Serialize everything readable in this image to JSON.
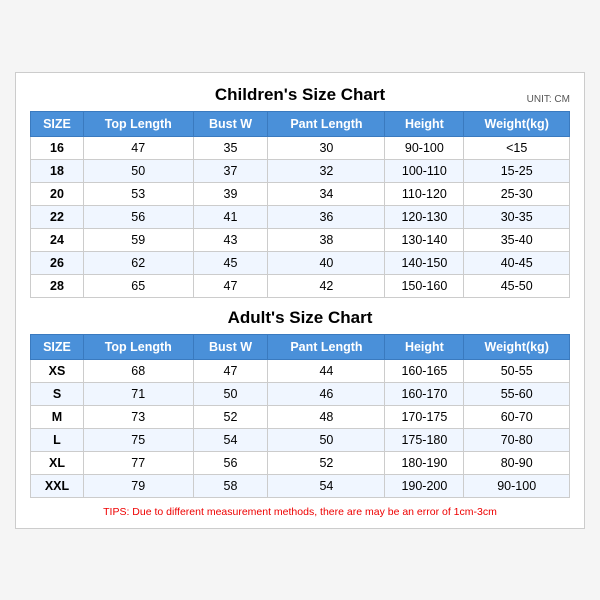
{
  "children": {
    "title": "Children's Size Chart",
    "unit": "UNIT: CM",
    "headers": [
      "SIZE",
      "Top Length",
      "Bust W",
      "Pant Length",
      "Height",
      "Weight(kg)"
    ],
    "rows": [
      [
        "16",
        "47",
        "35",
        "30",
        "90-100",
        "<15"
      ],
      [
        "18",
        "50",
        "37",
        "32",
        "100-110",
        "15-25"
      ],
      [
        "20",
        "53",
        "39",
        "34",
        "110-120",
        "25-30"
      ],
      [
        "22",
        "56",
        "41",
        "36",
        "120-130",
        "30-35"
      ],
      [
        "24",
        "59",
        "43",
        "38",
        "130-140",
        "35-40"
      ],
      [
        "26",
        "62",
        "45",
        "40",
        "140-150",
        "40-45"
      ],
      [
        "28",
        "65",
        "47",
        "42",
        "150-160",
        "45-50"
      ]
    ]
  },
  "adult": {
    "title": "Adult's Size Chart",
    "headers": [
      "SIZE",
      "Top Length",
      "Bust W",
      "Pant Length",
      "Height",
      "Weight(kg)"
    ],
    "rows": [
      [
        "XS",
        "68",
        "47",
        "44",
        "160-165",
        "50-55"
      ],
      [
        "S",
        "71",
        "50",
        "46",
        "160-170",
        "55-60"
      ],
      [
        "M",
        "73",
        "52",
        "48",
        "170-175",
        "60-70"
      ],
      [
        "L",
        "75",
        "54",
        "50",
        "175-180",
        "70-80"
      ],
      [
        "XL",
        "77",
        "56",
        "52",
        "180-190",
        "80-90"
      ],
      [
        "XXL",
        "79",
        "58",
        "54",
        "190-200",
        "90-100"
      ]
    ]
  },
  "tips": "TIPS: Due to different measurement methods, there are may be an error of 1cm-3cm"
}
